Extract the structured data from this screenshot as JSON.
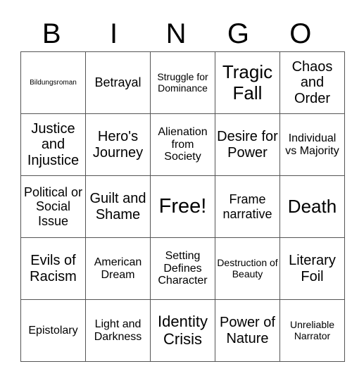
{
  "header": [
    "B",
    "I",
    "N",
    "G",
    "O"
  ],
  "rows": [
    [
      "Bildungsroman",
      "Betrayal",
      "Struggle for Dominance",
      "Tragic Fall",
      "Chaos and Order"
    ],
    [
      "Justice and Injustice",
      "Hero's Journey",
      "Alienation from Society",
      "Desire for Power",
      "Individual vs Majority"
    ],
    [
      "Political or Social Issue",
      "Guilt and Shame",
      "Free!",
      "Frame narrative",
      "Death"
    ],
    [
      "Evils of Racism",
      "American Dream",
      "Setting Defines Character",
      "Destruction of Beauty",
      "Literary Foil"
    ],
    [
      "Epistolary",
      "Light and Darkness",
      "Identity Crisis",
      "Power of Nature",
      "Unreliable Narrator"
    ]
  ]
}
